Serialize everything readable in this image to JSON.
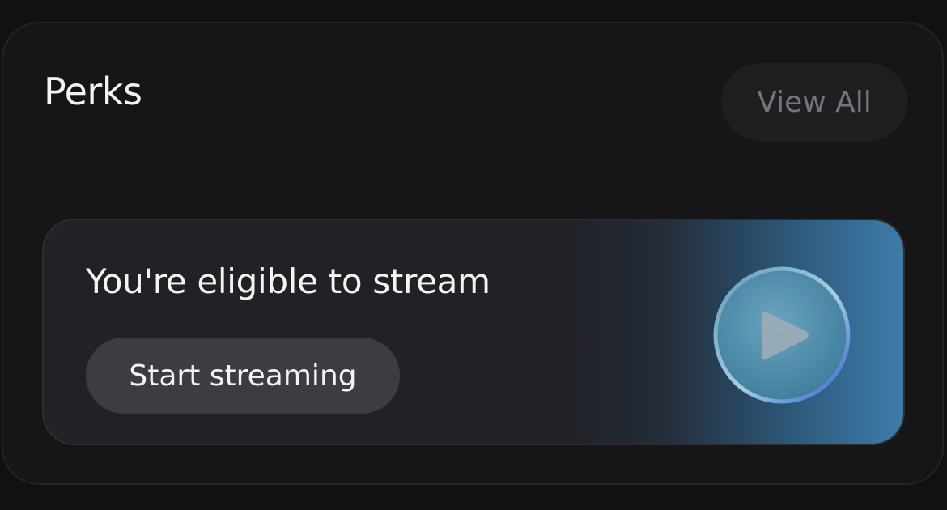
{
  "perks": {
    "title": "Perks",
    "view_all_label": "View All"
  },
  "stream_banner": {
    "title": "You're eligible to stream",
    "button_label": "Start streaming",
    "icon": "play-icon"
  },
  "colors": {
    "background": "#111113",
    "card": "#161619",
    "banner": "#212126",
    "button": "#3c3c42",
    "accent_blue": "#3e7caa"
  }
}
